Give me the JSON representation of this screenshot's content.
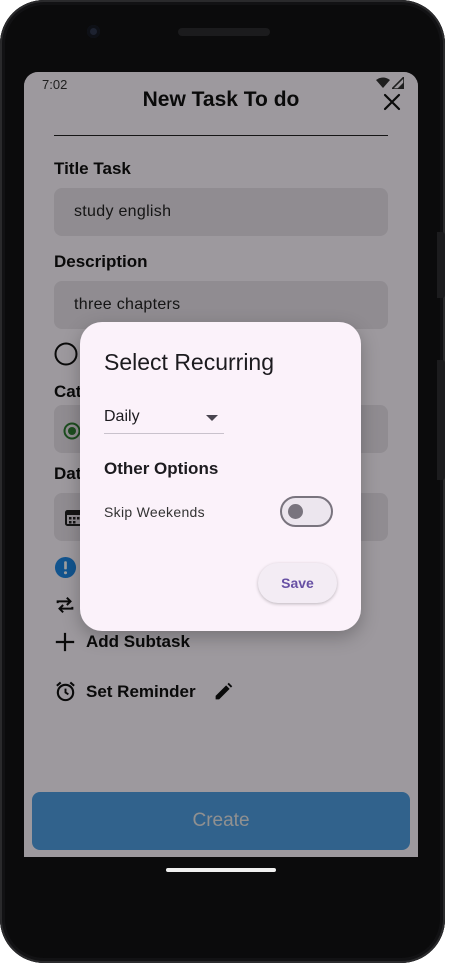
{
  "status_bar": {
    "time": "7:02"
  },
  "appbar": {
    "title": "New Task To do",
    "close_icon": "close-icon"
  },
  "form": {
    "title_label": "Title Task",
    "title_value": "study english",
    "description_label": "Description",
    "description_value": "three chapters",
    "category_label_partial": "Cat",
    "date_label_partial": "Dat",
    "add_subtask_label": "Add Subtask",
    "set_reminder_label": "Set Reminder",
    "create_label": "Create"
  },
  "dialog": {
    "title": "Select Recurring",
    "frequency_selected": "Daily",
    "other_options_heading": "Other Options",
    "skip_weekends_label": "Skip Weekends",
    "skip_weekends_enabled": false,
    "save_label": "Save"
  },
  "colors": {
    "accent": "#6750a4",
    "create_button": "#4f9fe3",
    "info_badge": "#1e88e5",
    "radio_selected": "#2e7d32"
  }
}
